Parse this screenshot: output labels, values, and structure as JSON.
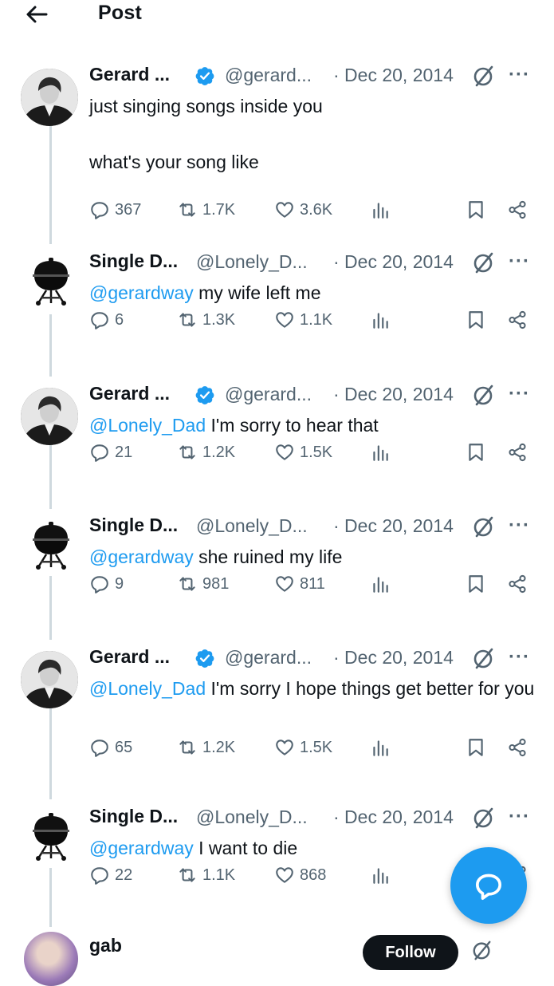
{
  "header": {
    "title": "Post"
  },
  "colors": {
    "accent": "#1d9bf0",
    "muted": "#536471",
    "text": "#0f1419",
    "thread_line": "#cfd9de"
  },
  "tweets": [
    {
      "name": "Gerard ...",
      "verified": true,
      "handle": "@gerard...",
      "date": "· Dec 20, 2014",
      "mention": "",
      "text": "just singing songs inside you\n\nwhat's your song like",
      "replies": "367",
      "reposts": "1.7K",
      "likes": "3.6K"
    },
    {
      "name": "Single D...",
      "verified": false,
      "handle": "@Lonely_D...",
      "date": "· Dec 20, 2014",
      "mention": "@gerardway",
      "text": " my wife left me",
      "replies": "6",
      "reposts": "1.3K",
      "likes": "1.1K"
    },
    {
      "name": "Gerard ...",
      "verified": true,
      "handle": "@gerard...",
      "date": "· Dec 20, 2014",
      "mention": "@Lonely_Dad",
      "text": " I'm sorry to hear that",
      "replies": "21",
      "reposts": "1.2K",
      "likes": "1.5K"
    },
    {
      "name": "Single D...",
      "verified": false,
      "handle": "@Lonely_D...",
      "date": "· Dec 20, 2014",
      "mention": "@gerardway",
      "text": " she ruined my life",
      "replies": "9",
      "reposts": "981",
      "likes": "811"
    },
    {
      "name": "Gerard ...",
      "verified": true,
      "handle": "@gerard...",
      "date": "· Dec 20, 2014",
      "mention": "@Lonely_Dad",
      "text": " I'm sorry I hope things get better for you",
      "replies": "65",
      "reposts": "1.2K",
      "likes": "1.5K"
    },
    {
      "name": "Single D...",
      "verified": false,
      "handle": "@Lonely_D...",
      "date": "· Dec 20, 2014",
      "mention": "@gerardway",
      "text": " I want to die",
      "replies": "22",
      "reposts": "1.1K",
      "likes": "868"
    }
  ],
  "more_label": "···",
  "peek": {
    "name": "gab",
    "follow_label": "Follow"
  }
}
